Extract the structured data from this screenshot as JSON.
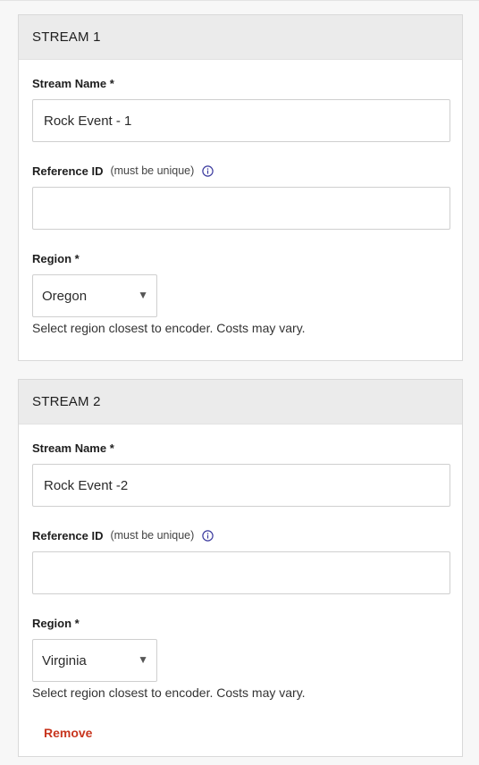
{
  "streams": [
    {
      "header": "STREAM 1",
      "name_label": "Stream Name *",
      "name_value": "Rock Event - 1",
      "ref_label": "Reference ID",
      "ref_hint": "(must be unique)",
      "ref_value": "",
      "region_label": "Region *",
      "region_value": "Oregon",
      "region_helper": "Select region closest to encoder. Costs may vary."
    },
    {
      "header": "STREAM 2",
      "name_label": "Stream Name *",
      "name_value": "Rock Event -2",
      "ref_label": "Reference ID",
      "ref_hint": "(must be unique)",
      "ref_value": "",
      "region_label": "Region *",
      "region_value": "Virginia",
      "region_helper": "Select region closest to encoder. Costs may vary.",
      "remove_label": "Remove"
    }
  ],
  "icons": {
    "info": "info-icon",
    "dropdown": "triangle-down-icon"
  },
  "colors": {
    "info_icon": "#3b3a9e",
    "remove_link": "#c8361f",
    "header_bg": "#ebebeb"
  }
}
